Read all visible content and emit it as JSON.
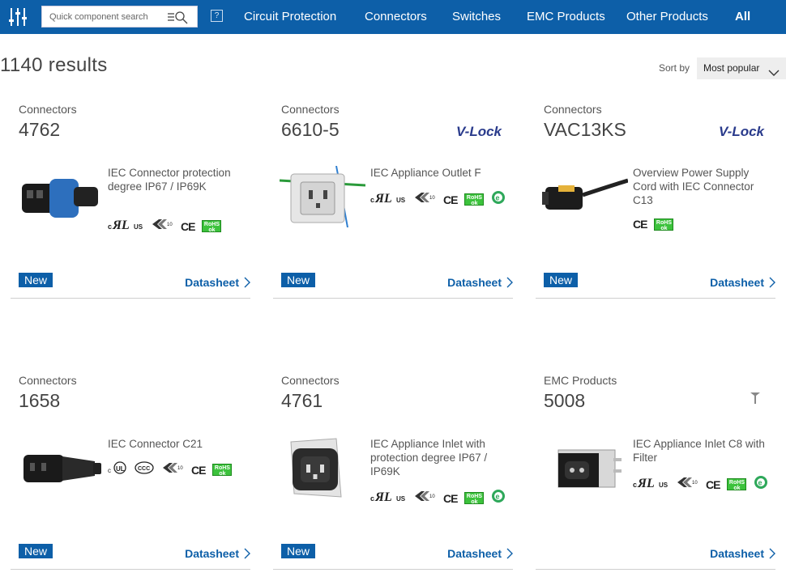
{
  "nav": {
    "search_placeholder": "Quick component search",
    "help": "?",
    "menu": [
      {
        "label": "Circuit Protection"
      },
      {
        "label": "Connectors"
      },
      {
        "label": "Switches"
      },
      {
        "label": "EMC Products"
      },
      {
        "label": "Other Products"
      },
      {
        "label": "All",
        "active": true
      }
    ]
  },
  "results": {
    "count": "1140  results",
    "sort_label": "Sort by",
    "sort_value": "Most popular"
  },
  "cards": [
    {
      "category": "Connectors",
      "number": "4762",
      "brand": "",
      "description": "IEC Connector protection degree IP67 / IP69K",
      "badge": "New",
      "datasheet": "Datasheet"
    },
    {
      "category": "Connectors",
      "number": "6610-5",
      "brand": "V-Lock",
      "description": "IEC Appliance Outlet F",
      "badge": "New",
      "datasheet": "Datasheet"
    },
    {
      "category": "Connectors",
      "number": "VAC13KS",
      "brand": "V-Lock",
      "description": "Overview Power Supply Cord with IEC Connector C13",
      "badge": "New",
      "datasheet": "Datasheet"
    },
    {
      "category": "Connectors",
      "number": "1658",
      "brand": "",
      "description": "IEC Connector C21",
      "badge": "New",
      "datasheet": "Datasheet"
    },
    {
      "category": "Connectors",
      "number": "4761",
      "brand": "",
      "description": "IEC Appliance Inlet with protection degree IP67 / IP69K",
      "badge": "New",
      "datasheet": "Datasheet"
    },
    {
      "category": "EMC Products",
      "number": "5008",
      "brand": "",
      "description": "IEC Appliance Inlet C8 with Filter",
      "badge": "",
      "datasheet": "Datasheet"
    }
  ],
  "certs": {
    "ul": "cULus",
    "ce": "CE",
    "enec": "ENEC 10",
    "rohs_1": "RoHS",
    "rohs_2": "ok"
  },
  "colors": {
    "nav_bg": "#0d5fa8",
    "link": "#0d5fa8",
    "badge": "#0d5fa8",
    "rohs": "#3cc23c",
    "brand": "#2a3b8c"
  }
}
